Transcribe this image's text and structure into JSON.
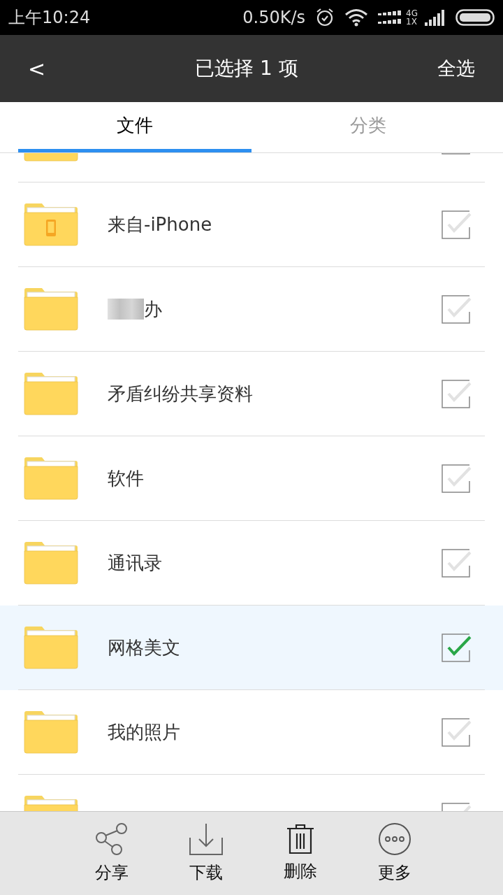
{
  "status_bar": {
    "time": "上午10:24",
    "speed": "0.50K/s",
    "network_top": "4G",
    "network_bottom": "1X"
  },
  "header": {
    "back": "<",
    "title": "已选择 1 项",
    "select_all": "全选"
  },
  "tabs": [
    {
      "label": "文件",
      "selected": true
    },
    {
      "label": "分类",
      "selected": false
    }
  ],
  "files": [
    {
      "kind": "cut_top",
      "selected": false
    },
    {
      "kind": "phone",
      "name": "来自-iPhone",
      "selected": false
    },
    {
      "kind": "redacted",
      "name": "办",
      "selected": false
    },
    {
      "kind": "folder",
      "name": "矛盾纠纷共享资料",
      "selected": false
    },
    {
      "kind": "folder",
      "name": "软件",
      "selected": false
    },
    {
      "kind": "folder",
      "name": "通讯录",
      "selected": false
    },
    {
      "kind": "folder",
      "name": "网格美文",
      "selected": true
    },
    {
      "kind": "folder",
      "name": "我的照片",
      "selected": false
    },
    {
      "kind": "cut_bottom",
      "selected": false
    }
  ],
  "actions": [
    {
      "kind": "share",
      "label": "分享"
    },
    {
      "kind": "download",
      "label": "下载"
    },
    {
      "kind": "delete",
      "label": "删除"
    },
    {
      "kind": "more",
      "label": "更多"
    }
  ]
}
